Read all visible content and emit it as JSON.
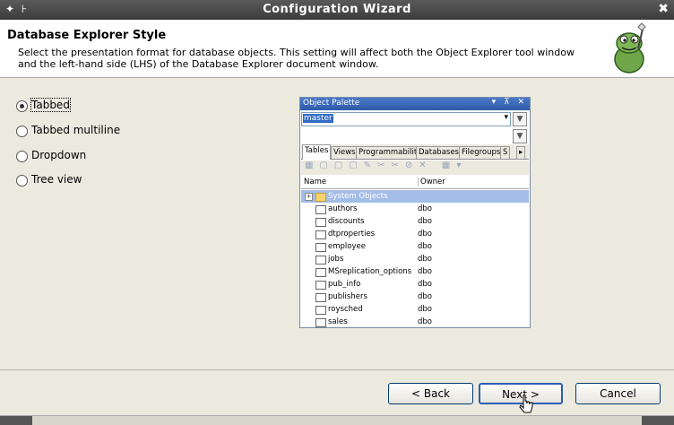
{
  "window": {
    "title": "Configuration Wizard",
    "left_controls": "✦ ⊦",
    "close": "✖"
  },
  "header": {
    "title": "Database Explorer Style",
    "description": "Select the presentation format for database objects.  This setting will affect both the Object Explorer tool window and the left-hand side (LHS) of the Database Explorer document window."
  },
  "options": [
    {
      "label": "Tabbed",
      "checked": true
    },
    {
      "label": "Tabbed multiline",
      "checked": false
    },
    {
      "label": "Dropdown",
      "checked": false
    },
    {
      "label": "Tree view",
      "checked": false
    }
  ],
  "preview": {
    "title": "Object Palette",
    "title_controls": "▾ ⊼ ✕",
    "database": "master",
    "tabs": [
      "Tables",
      "Views",
      "Programmability",
      "Databases",
      "Filegroups",
      "S"
    ],
    "active_tab": "Tables",
    "columns": {
      "name": "Name",
      "owner": "Owner"
    },
    "folder": "System Objects",
    "rows": [
      {
        "name": "authors",
        "owner": "dbo"
      },
      {
        "name": "discounts",
        "owner": "dbo"
      },
      {
        "name": "dtproperties",
        "owner": "dbo"
      },
      {
        "name": "employee",
        "owner": "dbo"
      },
      {
        "name": "jobs",
        "owner": "dbo"
      },
      {
        "name": "MSreplication_options",
        "owner": "dbo"
      },
      {
        "name": "pub_info",
        "owner": "dbo"
      },
      {
        "name": "publishers",
        "owner": "dbo"
      },
      {
        "name": "roysched",
        "owner": "dbo"
      },
      {
        "name": "sales",
        "owner": "dbo"
      }
    ]
  },
  "buttons": {
    "back": "< Back",
    "next": "Next >",
    "cancel": "Cancel"
  },
  "colors": {
    "titlebar": "#474747",
    "selection": "#316ac5",
    "default_button_border": "#2b5fb5"
  }
}
